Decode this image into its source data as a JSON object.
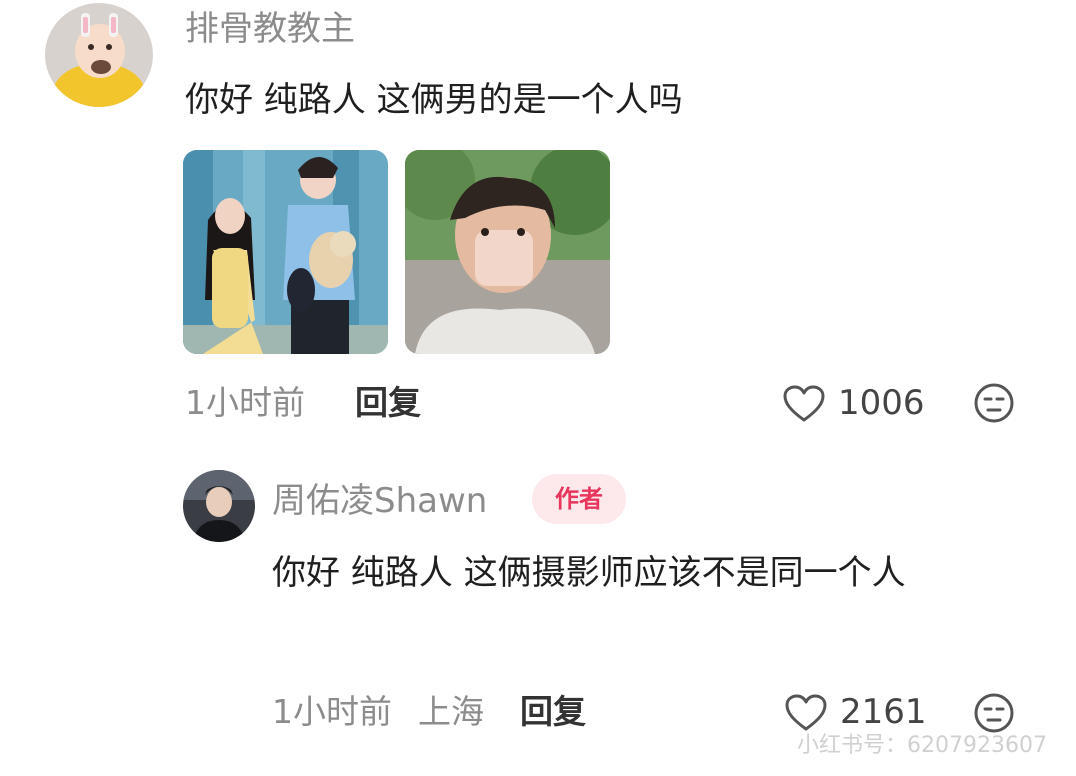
{
  "comment": {
    "username": "排骨教教主",
    "text": "你好 纯路人 这俩男的是一个人吗",
    "time": "1小时前",
    "reply_label": "回复",
    "likes": "1006"
  },
  "reply": {
    "username": "周佑凌Shawn",
    "badge": "作者",
    "text": "你好 纯路人 这俩摄影师应该不是同一个人",
    "time": "1小时前",
    "location": "上海",
    "reply_label": "回复",
    "likes": "2161"
  },
  "watermark": {
    "text": "小红书号：6207923607"
  },
  "icons": {
    "like": "heart-outline-icon",
    "dislike": "neutral-face-icon"
  },
  "colors": {
    "badge_bg": "#fde8ec",
    "badge_text": "#e8365d",
    "secondary_text": "#8c8c8c"
  }
}
